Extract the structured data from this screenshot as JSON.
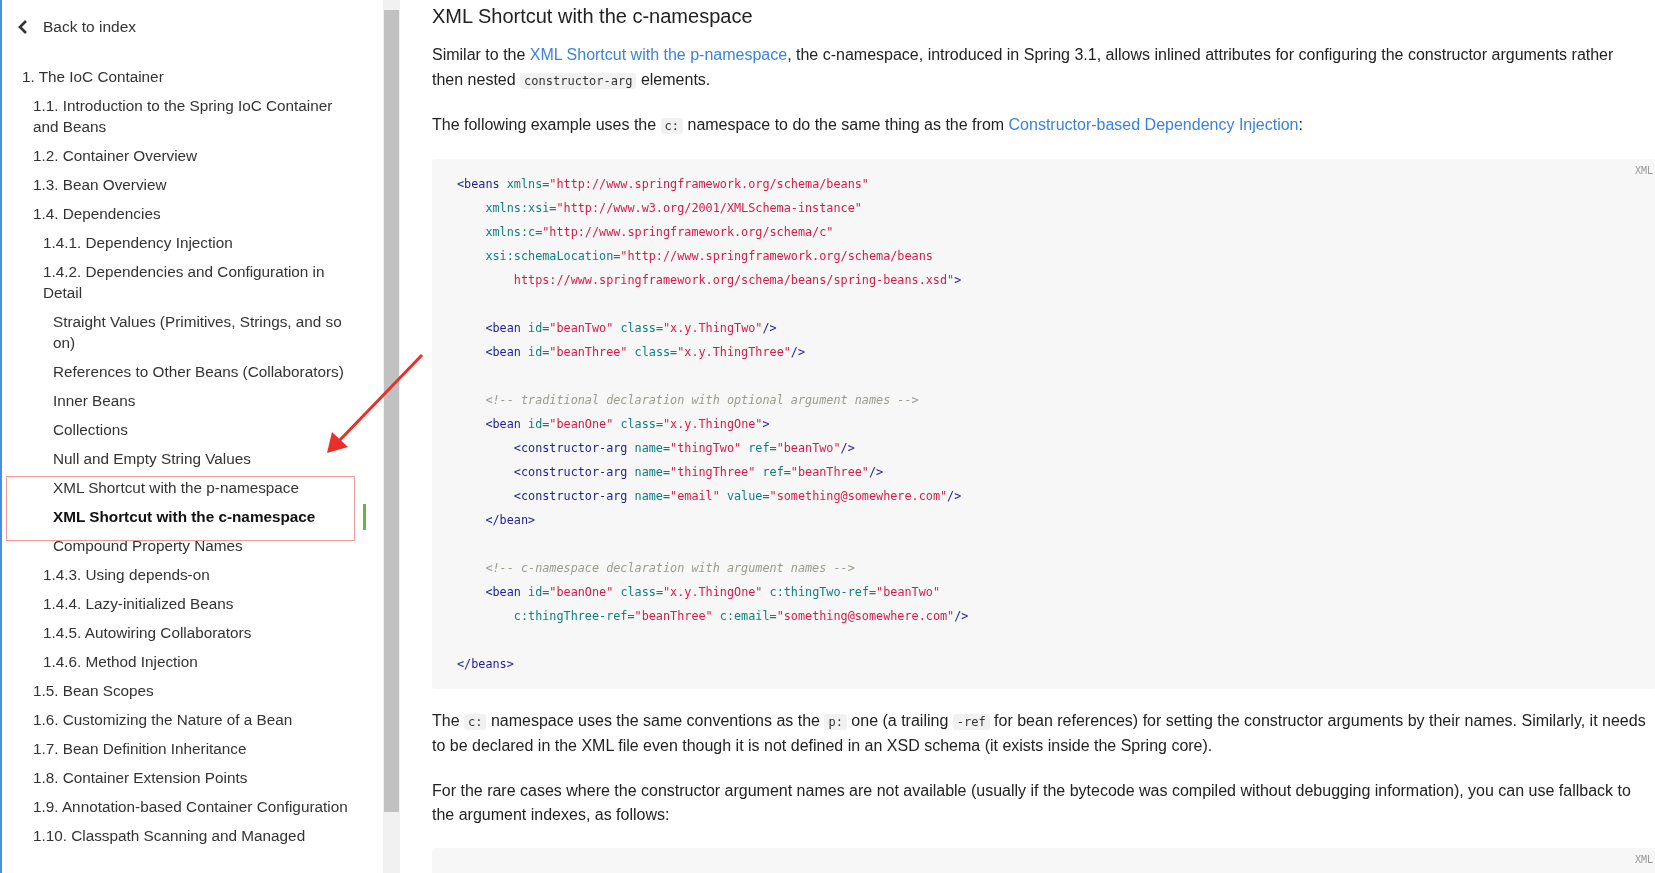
{
  "back_link": {
    "label": "Back to index"
  },
  "sidebar": {
    "items": [
      {
        "label": "1. The IoC Container",
        "selected": false,
        "children": [
          {
            "label": "1.1. Introduction to the Spring IoC Container and Beans",
            "selected": false
          },
          {
            "label": "1.2. Container Overview",
            "selected": false
          },
          {
            "label": "1.3. Bean Overview",
            "selected": false
          },
          {
            "label": "1.4. Dependencies",
            "selected": false,
            "children": [
              {
                "label": "1.4.1. Dependency Injection",
                "selected": false
              },
              {
                "label": "1.4.2. Dependencies and Configuration in Detail",
                "selected": false,
                "children": [
                  {
                    "label": "Straight Values (Primitives, Strings, and so on)",
                    "selected": false
                  },
                  {
                    "label": "References to Other Beans (Collaborators)",
                    "selected": false
                  },
                  {
                    "label": "Inner Beans",
                    "selected": false
                  },
                  {
                    "label": "Collections",
                    "selected": false
                  },
                  {
                    "label": "Null and Empty String Values",
                    "selected": false
                  },
                  {
                    "label": "XML Shortcut with the p-namespace",
                    "selected": false
                  },
                  {
                    "label": "XML Shortcut with the c-namespace",
                    "selected": true
                  },
                  {
                    "label": "Compound Property Names",
                    "selected": false
                  }
                ]
              },
              {
                "label": "1.4.3. Using depends-on",
                "selected": false
              },
              {
                "label": "1.4.4. Lazy-initialized Beans",
                "selected": false
              },
              {
                "label": "1.4.5. Autowiring Collaborators",
                "selected": false
              },
              {
                "label": "1.4.6. Method Injection",
                "selected": false
              }
            ]
          },
          {
            "label": "1.5. Bean Scopes",
            "selected": false
          },
          {
            "label": "1.6. Customizing the Nature of a Bean",
            "selected": false
          },
          {
            "label": "1.7. Bean Definition Inheritance",
            "selected": false
          },
          {
            "label": "1.8. Container Extension Points",
            "selected": false
          },
          {
            "label": "1.9. Annotation-based Container Configuration",
            "selected": false
          },
          {
            "label": "1.10. Classpath Scanning and Managed",
            "selected": false
          }
        ]
      }
    ]
  },
  "article": {
    "title": "XML Shortcut with the c-namespace",
    "blocks": [
      {
        "kind": "paragraph",
        "segments": [
          {
            "kind": "text",
            "t": "Similar to the "
          },
          {
            "kind": "link",
            "t": "XML Shortcut with the p-namespace"
          },
          {
            "kind": "text",
            "t": ", the c-namespace, introduced in Spring 3.1, allows inlined attributes for configuring the constructor arguments rather then nested "
          },
          {
            "kind": "code",
            "t": "constructor-arg"
          },
          {
            "kind": "text",
            "t": " elements."
          }
        ]
      },
      {
        "kind": "paragraph",
        "segments": [
          {
            "kind": "text",
            "t": "The following example uses the "
          },
          {
            "kind": "code",
            "t": "c:"
          },
          {
            "kind": "text",
            "t": " namespace to do the same thing as the from "
          },
          {
            "kind": "link",
            "t": "Constructor-based Dependency Injection"
          },
          {
            "kind": "text",
            "t": ":"
          }
        ]
      },
      {
        "kind": "code",
        "label": "XML",
        "lines": [
          {
            "kind": "code",
            "tokens": [
              {
                "kind": "tag",
                "t": "<beans "
              },
              {
                "kind": "attr",
                "t": "xmlns="
              },
              {
                "kind": "str",
                "t": "\"http://www.springframework.org/schema/beans\""
              }
            ]
          },
          {
            "kind": "code",
            "tokens": [
              {
                "kind": "attr",
                "t": "    xmlns:xsi="
              },
              {
                "kind": "str",
                "t": "\"http://www.w3.org/2001/XMLSchema-instance\""
              }
            ]
          },
          {
            "kind": "code",
            "tokens": [
              {
                "kind": "attr",
                "t": "    xmlns:c="
              },
              {
                "kind": "str",
                "t": "\"http://www.springframework.org/schema/c\""
              }
            ]
          },
          {
            "kind": "code",
            "tokens": [
              {
                "kind": "attr",
                "t": "    xsi:schemaLocation="
              },
              {
                "kind": "str",
                "t": "\"http://www.springframework.org/schema/beans"
              }
            ]
          },
          {
            "kind": "code",
            "tokens": [
              {
                "kind": "str",
                "t": "        https://www.springframework.org/schema/beans/spring-beans.xsd\""
              },
              {
                "kind": "tag",
                "t": ">"
              }
            ]
          },
          {
            "kind": "blank"
          },
          {
            "kind": "code",
            "tokens": [
              {
                "kind": "tag",
                "t": "    <bean "
              },
              {
                "kind": "attr",
                "t": "id="
              },
              {
                "kind": "str",
                "t": "\"beanTwo\" "
              },
              {
                "kind": "attr",
                "t": "class="
              },
              {
                "kind": "str",
                "t": "\"x.y.ThingTwo\""
              },
              {
                "kind": "tag",
                "t": "/>"
              }
            ]
          },
          {
            "kind": "code",
            "tokens": [
              {
                "kind": "tag",
                "t": "    <bean "
              },
              {
                "kind": "attr",
                "t": "id="
              },
              {
                "kind": "str",
                "t": "\"beanThree\" "
              },
              {
                "kind": "attr",
                "t": "class="
              },
              {
                "kind": "str",
                "t": "\"x.y.ThingThree\""
              },
              {
                "kind": "tag",
                "t": "/>"
              }
            ]
          },
          {
            "kind": "blank"
          },
          {
            "kind": "code",
            "tokens": [
              {
                "kind": "comment",
                "t": "    <!-- traditional declaration with optional argument names -->"
              }
            ]
          },
          {
            "kind": "code",
            "tokens": [
              {
                "kind": "tag",
                "t": "    <bean "
              },
              {
                "kind": "attr",
                "t": "id="
              },
              {
                "kind": "str",
                "t": "\"beanOne\" "
              },
              {
                "kind": "attr",
                "t": "class="
              },
              {
                "kind": "str",
                "t": "\"x.y.ThingOne\""
              },
              {
                "kind": "tag",
                "t": ">"
              }
            ]
          },
          {
            "kind": "code",
            "tokens": [
              {
                "kind": "tag",
                "t": "        <constructor-arg "
              },
              {
                "kind": "attr",
                "t": "name="
              },
              {
                "kind": "str",
                "t": "\"thingTwo\" "
              },
              {
                "kind": "attr",
                "t": "ref="
              },
              {
                "kind": "str",
                "t": "\"beanTwo\""
              },
              {
                "kind": "tag",
                "t": "/>"
              }
            ]
          },
          {
            "kind": "code",
            "tokens": [
              {
                "kind": "tag",
                "t": "        <constructor-arg "
              },
              {
                "kind": "attr",
                "t": "name="
              },
              {
                "kind": "str",
                "t": "\"thingThree\" "
              },
              {
                "kind": "attr",
                "t": "ref="
              },
              {
                "kind": "str",
                "t": "\"beanThree\""
              },
              {
                "kind": "tag",
                "t": "/>"
              }
            ]
          },
          {
            "kind": "code",
            "tokens": [
              {
                "kind": "tag",
                "t": "        <constructor-arg "
              },
              {
                "kind": "attr",
                "t": "name="
              },
              {
                "kind": "str",
                "t": "\"email\" "
              },
              {
                "kind": "attr",
                "t": "value="
              },
              {
                "kind": "str",
                "t": "\"something@somewhere.com\""
              },
              {
                "kind": "tag",
                "t": "/>"
              }
            ]
          },
          {
            "kind": "code",
            "tokens": [
              {
                "kind": "tag",
                "t": "    </bean>"
              }
            ]
          },
          {
            "kind": "blank"
          },
          {
            "kind": "code",
            "tokens": [
              {
                "kind": "comment",
                "t": "    <!-- c-namespace declaration with argument names -->"
              }
            ]
          },
          {
            "kind": "code",
            "tokens": [
              {
                "kind": "tag",
                "t": "    <bean "
              },
              {
                "kind": "attr",
                "t": "id="
              },
              {
                "kind": "str",
                "t": "\"beanOne\" "
              },
              {
                "kind": "attr",
                "t": "class="
              },
              {
                "kind": "str",
                "t": "\"x.y.ThingOne\" "
              },
              {
                "kind": "attr",
                "t": "c:thingTwo-ref="
              },
              {
                "kind": "str",
                "t": "\"beanTwo\""
              }
            ]
          },
          {
            "kind": "code",
            "tokens": [
              {
                "kind": "attr",
                "t": "        c:thingThree-ref="
              },
              {
                "kind": "str",
                "t": "\"beanThree\" "
              },
              {
                "kind": "attr",
                "t": "c:email="
              },
              {
                "kind": "str",
                "t": "\"something@somewhere.com\""
              },
              {
                "kind": "tag",
                "t": "/>"
              }
            ]
          },
          {
            "kind": "blank"
          },
          {
            "kind": "code",
            "tokens": [
              {
                "kind": "tag",
                "t": "</beans>"
              }
            ]
          }
        ]
      },
      {
        "kind": "paragraph",
        "segments": [
          {
            "kind": "text",
            "t": "The "
          },
          {
            "kind": "code",
            "t": "c:"
          },
          {
            "kind": "text",
            "t": " namespace uses the same conventions as the "
          },
          {
            "kind": "code",
            "t": "p:"
          },
          {
            "kind": "text",
            "t": " one (a trailing "
          },
          {
            "kind": "code",
            "t": "-ref"
          },
          {
            "kind": "text",
            "t": " for bean references) for setting the constructor arguments by their names. Similarly, it needs to be declared in the XML file even though it is not defined in an XSD schema (it exists inside the Spring core)."
          }
        ]
      },
      {
        "kind": "paragraph",
        "segments": [
          {
            "kind": "text",
            "t": "For the rare cases where the constructor argument names are not available (usually if the bytecode was compiled without debugging information), you can use fallback to the argument indexes, as follows:"
          }
        ]
      },
      {
        "kind": "code",
        "label": "XML"
      }
    ]
  }
}
